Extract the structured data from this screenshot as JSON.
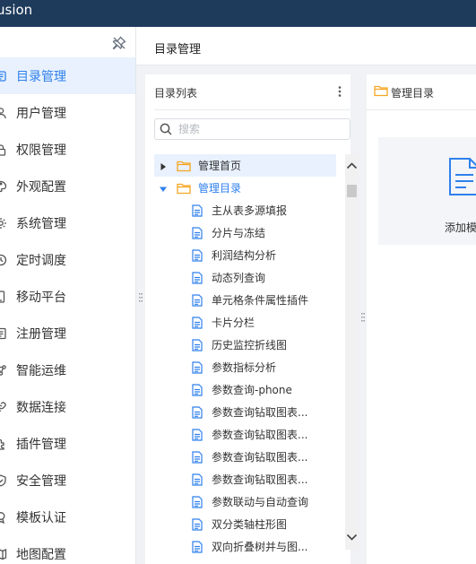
{
  "app": {
    "title": "usion"
  },
  "sidebar": {
    "items": [
      {
        "label": "目录管理",
        "icon": "catalog-icon",
        "active": true
      },
      {
        "label": "用户管理",
        "icon": "user-icon"
      },
      {
        "label": "权限管理",
        "icon": "permission-icon"
      },
      {
        "label": "外观配置",
        "icon": "appearance-icon"
      },
      {
        "label": "系统管理",
        "icon": "system-gear-icon"
      },
      {
        "label": "定时调度",
        "icon": "clock-icon"
      },
      {
        "label": "移动平台",
        "icon": "mobile-icon"
      },
      {
        "label": "注册管理",
        "icon": "register-icon"
      },
      {
        "label": "智能运维",
        "icon": "ops-icon"
      },
      {
        "label": "数据连接",
        "icon": "link-icon"
      },
      {
        "label": "插件管理",
        "icon": "plugin-icon"
      },
      {
        "label": "安全管理",
        "icon": "shield-icon"
      },
      {
        "label": "模板认证",
        "icon": "template-auth-icon"
      },
      {
        "label": "地图配置",
        "icon": "map-icon"
      }
    ]
  },
  "page": {
    "title": "目录管理"
  },
  "catalog_panel": {
    "title": "目录列表",
    "search_placeholder": "搜索",
    "tree": [
      {
        "label": "管理首页",
        "level": 0,
        "expanded": false,
        "selected": true
      },
      {
        "label": "管理目录",
        "level": 0,
        "expanded": true
      },
      {
        "label": "主从表多源填报",
        "level": 1
      },
      {
        "label": "分片与冻结",
        "level": 1
      },
      {
        "label": "利润结构分析",
        "level": 1
      },
      {
        "label": "动态列查询",
        "level": 1
      },
      {
        "label": "单元格条件属性插件",
        "level": 1
      },
      {
        "label": "卡片分栏",
        "level": 1
      },
      {
        "label": "历史监控折线图",
        "level": 1
      },
      {
        "label": "参数指标分析",
        "level": 1
      },
      {
        "label": "参数查询-phone",
        "level": 1
      },
      {
        "label": "参数查询钻取图表...",
        "level": 1
      },
      {
        "label": "参数查询钻取图表...",
        "level": 1
      },
      {
        "label": "参数查询钻取图表...",
        "level": 1
      },
      {
        "label": "参数查询钻取图表...",
        "level": 1
      },
      {
        "label": "参数联动与自动查询",
        "level": 1
      },
      {
        "label": "双分类轴柱形图",
        "level": 1
      },
      {
        "label": "双向折叠树并与图...",
        "level": 1
      }
    ]
  },
  "detail_panel": {
    "title": "管理目录",
    "add_card_label": "添加模"
  },
  "colors": {
    "topbar": "#1f3b5c",
    "accent": "#2f80ed",
    "folder": "#f5a623",
    "active_bg": "#e8f1fd"
  }
}
